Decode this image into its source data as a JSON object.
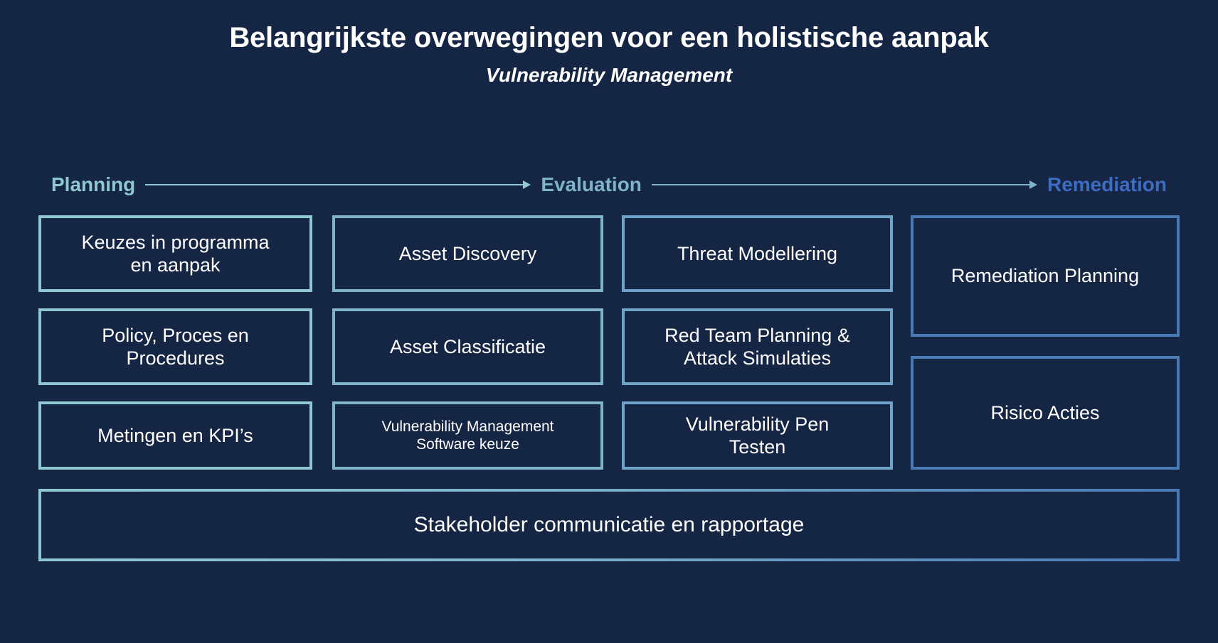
{
  "slide": {
    "background_color": "#152544",
    "title": "Belangrijkste overwegingen voor een holistische aanpak",
    "subtitle": "Vulnerability Management"
  },
  "phases": [
    {
      "label": "Planning",
      "color": "#8fc8d2",
      "arrow_color": "#8fc8d2"
    },
    {
      "label": "Evaluation",
      "color": "#7fb3c9",
      "arrow_color": "#7fb3c9"
    },
    {
      "label": "Remediation",
      "color": "#3d6cc0",
      "arrow_color": "#7fb3c9"
    }
  ],
  "columns": [
    {
      "phase": "Planning",
      "border_color": "#8fc8d2",
      "cells": [
        {
          "text": "Keuzes in programma\nen aanpak"
        },
        {
          "text": "Policy, Proces en\nProcedures"
        },
        {
          "text": "Metingen en KPI’s"
        }
      ]
    },
    {
      "phase": "Evaluation",
      "border_color": "#7fb3c9",
      "cells": [
        {
          "text": "Asset Discovery"
        },
        {
          "text": "Asset Classificatie"
        },
        {
          "text": "Vulnerability Management\nSoftware keuze",
          "small": true
        }
      ]
    },
    {
      "phase": "Evaluation",
      "border_color": "#6fa3c7",
      "cells": [
        {
          "text": "Threat Modellering"
        },
        {
          "text": "Red Team Planning &\nAttack Simulaties"
        },
        {
          "text": "Vulnerability Pen\nTesten"
        }
      ]
    },
    {
      "phase": "Remediation",
      "border_color": "#4a7ab5",
      "cells": [
        {
          "text": "Remediation Planning"
        },
        {
          "text": "Risico Acties"
        }
      ]
    }
  ],
  "bottom_bar": {
    "text": "Stakeholder communicatie en rapportage",
    "border_gradient_start": "#8fc8d2",
    "border_gradient_end": "#4a7ab5"
  }
}
